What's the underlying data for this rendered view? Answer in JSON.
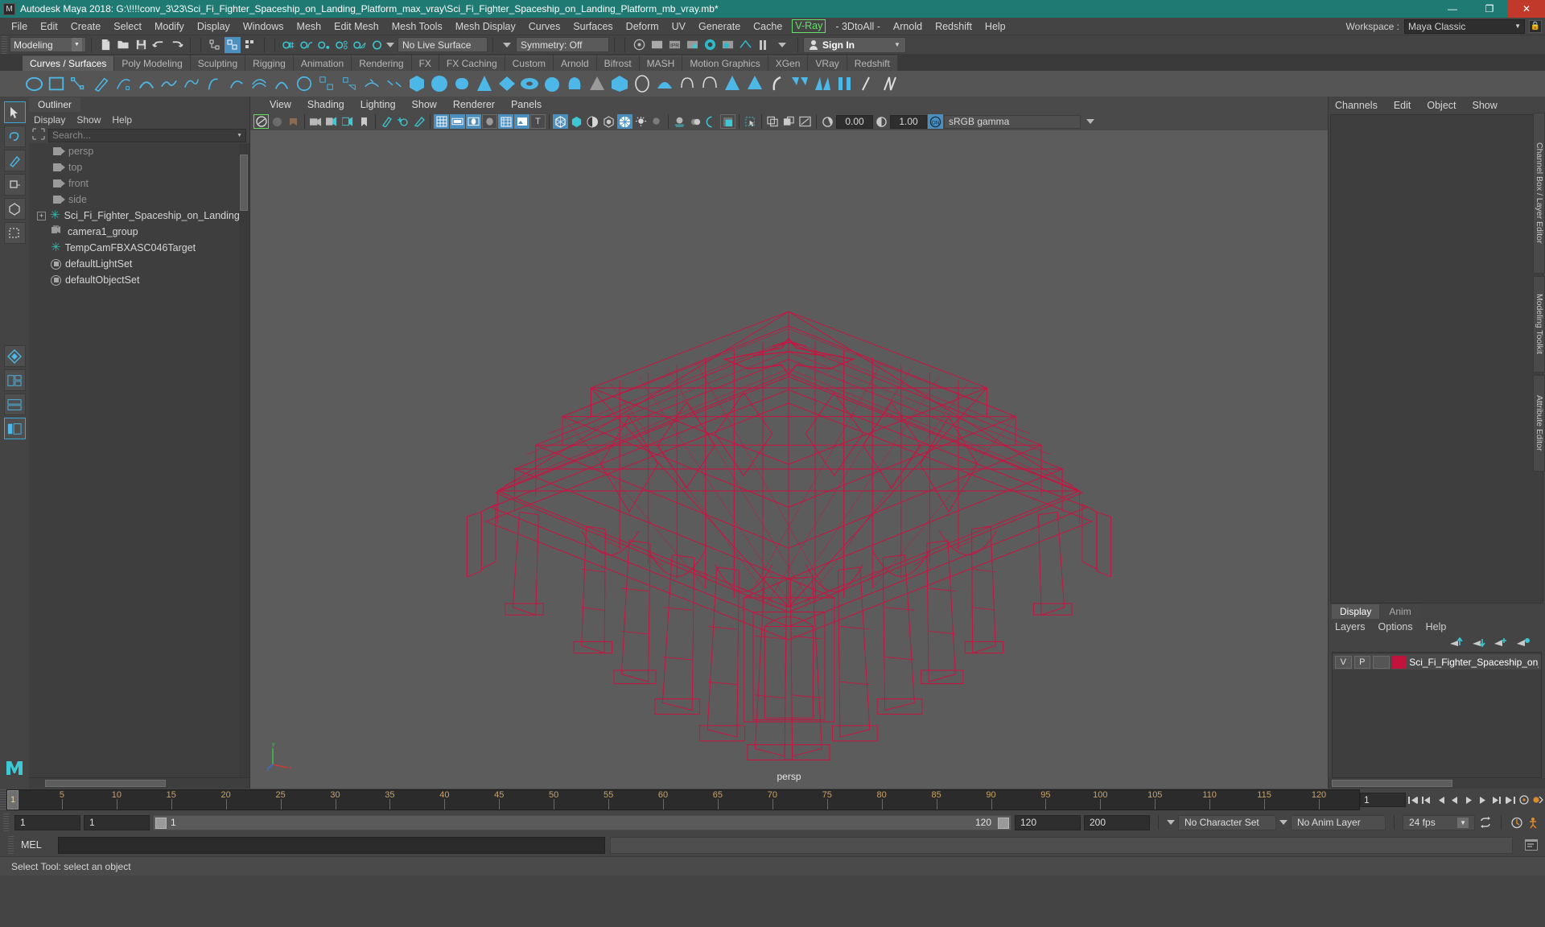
{
  "window": {
    "title": "Autodesk Maya 2018: G:\\!!!!conv_3\\23\\Sci_Fi_Fighter_Spaceship_on_Landing_Platform_max_vray\\Sci_Fi_Fighter_Spaceship_on_Landing_Platform_mb_vray.mb*",
    "app_icon": "maya-icon",
    "minimize": "—",
    "maximize": "❐",
    "close": "✕"
  },
  "menubar": {
    "items": [
      "File",
      "Edit",
      "Create",
      "Select",
      "Modify",
      "Display",
      "Windows",
      "Mesh",
      "Edit Mesh",
      "Mesh Tools",
      "Mesh Display",
      "Curves",
      "Surfaces",
      "Deform",
      "UV",
      "Generate",
      "Cache"
    ],
    "highlight": "V-Ray",
    "items_after": [
      "- 3DtoAll -",
      "Arnold",
      "Redshift",
      "Help"
    ],
    "workspace_label": "Workspace :",
    "workspace_value": "Maya Classic",
    "lock_icon": "lock-icon"
  },
  "statusline": {
    "mode": "Modeling",
    "live_surface": "No Live Surface",
    "symmetry": "Symmetry: Off",
    "signin": "Sign In"
  },
  "shelf": {
    "tabs": [
      "Curves / Surfaces",
      "Poly Modeling",
      "Sculpting",
      "Rigging",
      "Animation",
      "Rendering",
      "FX",
      "FX Caching",
      "Custom",
      "Arnold",
      "Bifrost",
      "MASH",
      "Motion Graphics",
      "XGen",
      "VRay",
      "Redshift"
    ],
    "active_tab": "Curves / Surfaces"
  },
  "outliner": {
    "tab": "Outliner",
    "menus": [
      "Display",
      "Show",
      "Help"
    ],
    "search_placeholder": "Search...",
    "items": [
      {
        "label": "persp",
        "icon": "camera-icon",
        "dim": true,
        "expand": false
      },
      {
        "label": "top",
        "icon": "camera-icon",
        "dim": true,
        "expand": false
      },
      {
        "label": "front",
        "icon": "camera-icon",
        "dim": true,
        "expand": false
      },
      {
        "label": "side",
        "icon": "camera-icon",
        "dim": true,
        "expand": false
      },
      {
        "label": "Sci_Fi_Fighter_Spaceship_on_Landing",
        "icon": "transform-icon",
        "dim": false,
        "expand": true
      },
      {
        "label": "camera1_group",
        "icon": "camera-group-icon",
        "dim": false,
        "expand": false
      },
      {
        "label": "TempCamFBXASC046Target",
        "icon": "transform-icon",
        "dim": false,
        "expand": false
      },
      {
        "label": "defaultLightSet",
        "icon": "set-icon",
        "dim": false,
        "expand": false
      },
      {
        "label": "defaultObjectSet",
        "icon": "set-icon",
        "dim": false,
        "expand": false
      }
    ]
  },
  "viewport": {
    "menus": [
      "View",
      "Shading",
      "Lighting",
      "Show",
      "Renderer",
      "Panels"
    ],
    "exposure": "0.00",
    "gamma": "1.00",
    "color_management": "sRGB gamma",
    "camera_label": "persp",
    "axis": {
      "x": "x",
      "y": "y",
      "z": "z"
    },
    "wireframe_color": "#cf1040",
    "background_color": "#5c5c5c"
  },
  "channelbox": {
    "tabs": [
      "Channels",
      "Edit",
      "Object",
      "Show"
    ],
    "side_tabs": [
      "Channel Box / Layer Editor",
      "Modeling Toolkit",
      "Attribute Editor"
    ]
  },
  "layers": {
    "tabs": [
      "Display",
      "Anim"
    ],
    "active_tab": "Display",
    "menus": [
      "Layers",
      "Options",
      "Help"
    ],
    "buttons": [
      "move-layer-up-icon",
      "move-layer-down-icon",
      "new-layer-icon",
      "new-layer-from-selected-icon"
    ],
    "rows": [
      {
        "v": "V",
        "p": "P",
        "shade": "",
        "color": "#c0143c",
        "name": "Sci_Fi_Fighter_Spaceship_on_L"
      }
    ]
  },
  "timeline": {
    "ticks": [
      "5",
      "10",
      "15",
      "20",
      "25",
      "30",
      "35",
      "40",
      "45",
      "50",
      "55",
      "60",
      "65",
      "70",
      "75",
      "80",
      "85",
      "90",
      "95",
      "100",
      "105",
      "110",
      "115",
      "120"
    ],
    "current_frame": "1",
    "current_frame_field": "1",
    "playback_buttons": [
      "go-to-start-icon",
      "step-back-key-icon",
      "step-back-frame-icon",
      "play-backwards-icon",
      "play-forwards-icon",
      "step-forward-frame-icon",
      "step-forward-key-icon",
      "go-to-end-icon"
    ]
  },
  "rangebar": {
    "range_start": "1",
    "anim_start": "1",
    "slider_start_label": "1",
    "slider_end_label": "120",
    "anim_end": "120",
    "range_end": "200",
    "character_set": "No Character Set",
    "anim_layer": "No Anim Layer",
    "fps": "24 fps"
  },
  "command": {
    "label": "MEL",
    "input_value": "",
    "output_value": ""
  },
  "statusbar": {
    "help_text": "Select Tool: select an object"
  }
}
